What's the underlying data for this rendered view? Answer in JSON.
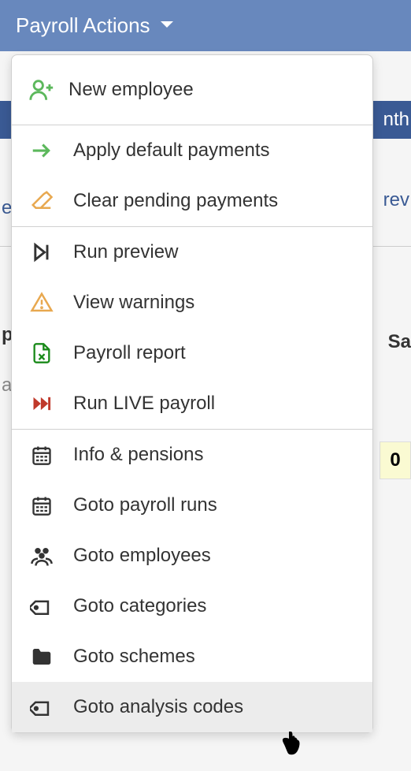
{
  "header": {
    "title": "Payroll Actions"
  },
  "background": {
    "sub_header_text": "nth",
    "blue_link_text": "rev",
    "left_trunc_1": "e",
    "left_trunc_2": "p",
    "right_trunc": "Sa",
    "left_trunc_3": "a",
    "yellow_value": "0"
  },
  "menu": {
    "groups": [
      {
        "items": [
          {
            "name": "new-employee",
            "label": "New employee",
            "icon": "user-plus",
            "icon_color": "#5cb85c"
          }
        ]
      },
      {
        "items": [
          {
            "name": "apply-default-payments",
            "label": "Apply default payments",
            "icon": "arrow-right",
            "icon_color": "#5cb85c"
          },
          {
            "name": "clear-pending-payments",
            "label": "Clear pending payments",
            "icon": "eraser",
            "icon_color": "#e8a84f"
          }
        ]
      },
      {
        "items": [
          {
            "name": "run-preview",
            "label": "Run preview",
            "icon": "skip-next",
            "icon_color": "#333333"
          },
          {
            "name": "view-warnings",
            "label": "View warnings",
            "icon": "warning",
            "icon_color": "#e8a84f"
          },
          {
            "name": "payroll-report",
            "label": "Payroll report",
            "icon": "file-excel",
            "icon_color": "#1a8a1a"
          },
          {
            "name": "run-live-payroll",
            "label": "Run LIVE payroll",
            "icon": "fast-forward",
            "icon_color": "#c0392b"
          }
        ]
      },
      {
        "items": [
          {
            "name": "info-pensions",
            "label": "Info & pensions",
            "icon": "calendar",
            "icon_color": "#333333"
          },
          {
            "name": "goto-payroll-runs",
            "label": "Goto payroll runs",
            "icon": "calendar",
            "icon_color": "#333333"
          },
          {
            "name": "goto-employees",
            "label": "Goto employees",
            "icon": "users",
            "icon_color": "#333333"
          },
          {
            "name": "goto-categories",
            "label": "Goto categories",
            "icon": "tag",
            "icon_color": "#333333"
          },
          {
            "name": "goto-schemes",
            "label": "Goto schemes",
            "icon": "folder",
            "icon_color": "#333333"
          },
          {
            "name": "goto-analysis-codes",
            "label": "Goto analysis codes",
            "icon": "tag",
            "icon_color": "#333333",
            "hovered": true
          }
        ]
      }
    ]
  }
}
